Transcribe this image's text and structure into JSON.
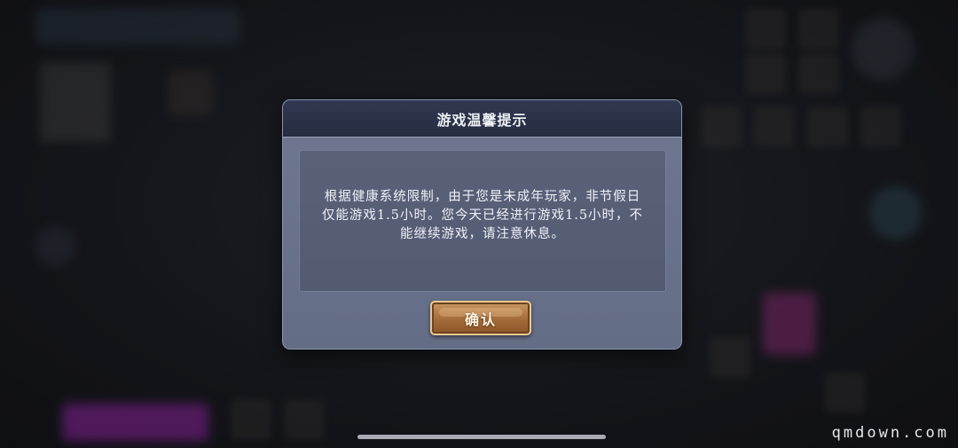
{
  "dialog": {
    "title": "游戏温馨提示",
    "message": "根据健康系统限制，由于您是未成年玩家，非节假日仅能游戏1.5小时。您今天已经进行游戏1.5小时，不能继续游戏，请注意休息。",
    "confirm_label": "确认"
  },
  "watermark": "qmdown.com",
  "colors": {
    "dialog_header": "#2b3147",
    "dialog_body": "#6b7490",
    "content_box": "#565e77",
    "confirm_button": "#b07a45",
    "confirm_border": "#e6c892"
  }
}
